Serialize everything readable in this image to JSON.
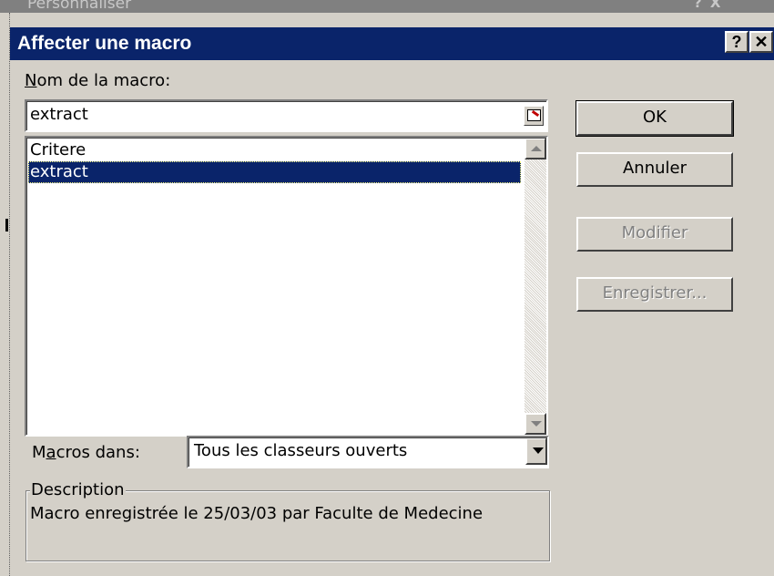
{
  "background_window": {
    "title": "Personnaliser",
    "buttons": "? X"
  },
  "dialog": {
    "title": "Affecter une macro",
    "help_button": "?",
    "close_button": "✕"
  },
  "macro_name": {
    "label_first": "N",
    "label_rest": "om de la macro:",
    "value": "extract"
  },
  "macro_list": {
    "items": [
      "Critere",
      "extract"
    ],
    "selected": "extract"
  },
  "macros_in": {
    "label_pre": "M",
    "label_ul": "a",
    "label_post": "cros dans:",
    "value": "Tous les classeurs ouverts"
  },
  "description": {
    "legend": "Description",
    "text": "Macro enregistrée le 25/03/03 par Faculte de Medecine"
  },
  "buttons": {
    "ok": "OK",
    "cancel": "Annuler",
    "modify": "Modifier",
    "record": "Enregistrer..."
  },
  "colors": {
    "titlebar": "#0a246a",
    "face": "#d4d0c8",
    "selection": "#0a246a"
  }
}
